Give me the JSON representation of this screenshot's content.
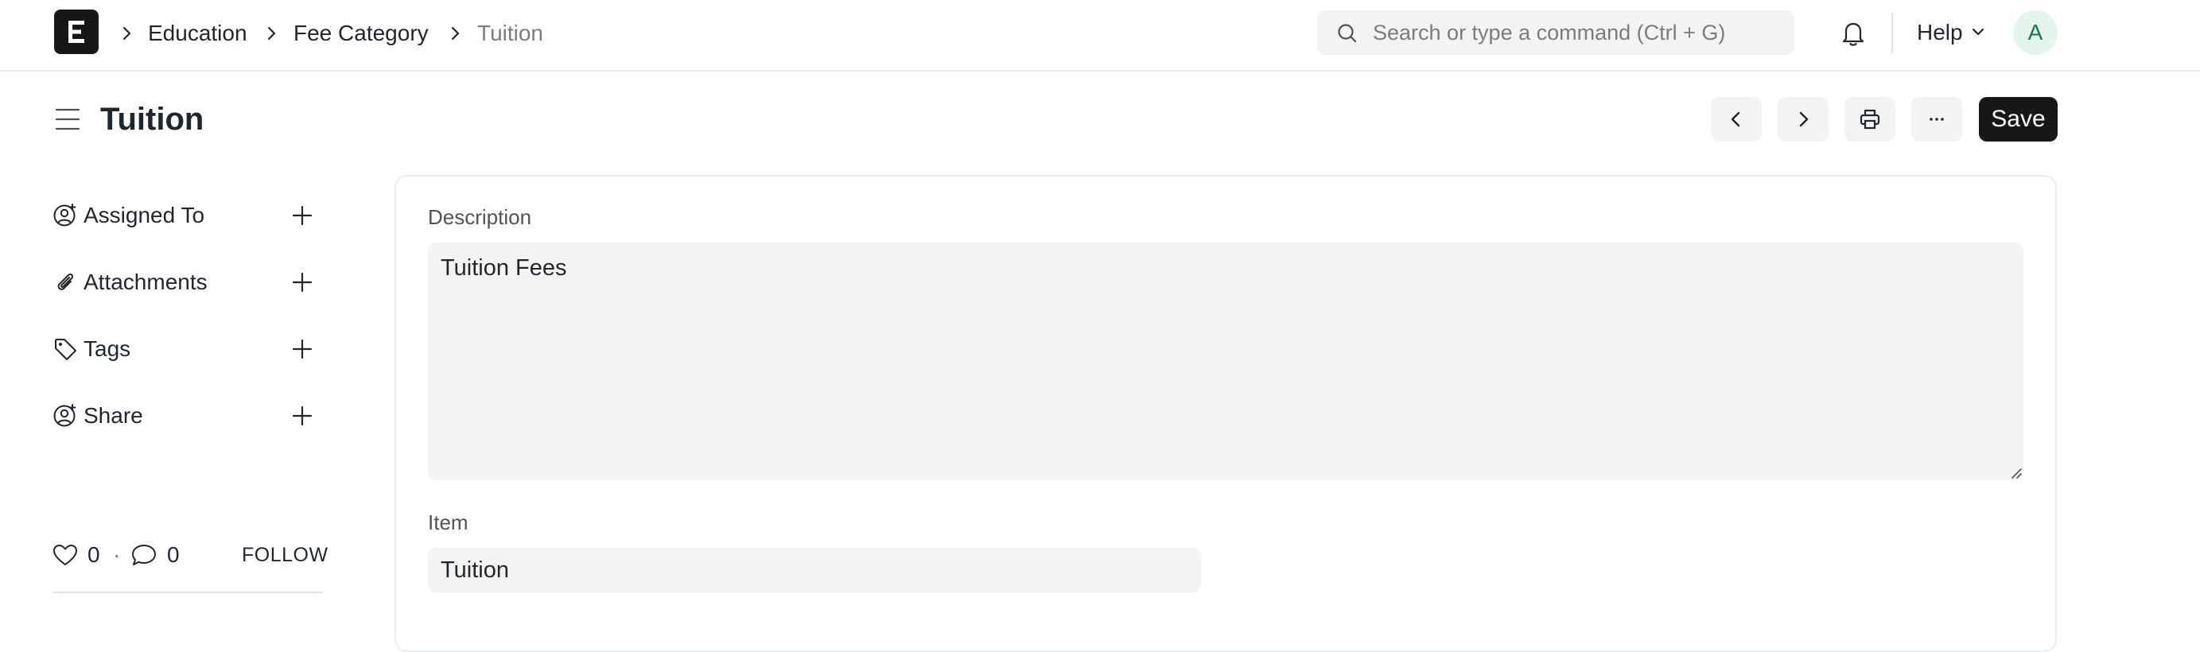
{
  "navbar": {
    "breadcrumbs": [
      {
        "label": "Education"
      },
      {
        "label": "Fee Category"
      },
      {
        "label": "Tuition"
      }
    ],
    "search": {
      "placeholder": "Search or type a command (Ctrl + G)"
    },
    "help_label": "Help",
    "avatar_initial": "A"
  },
  "page": {
    "title": "Tuition",
    "save_label": "Save",
    "more_label": "···"
  },
  "sidebar": {
    "items": [
      {
        "label": "Assigned To",
        "icon": "user-add-icon"
      },
      {
        "label": "Attachments",
        "icon": "paperclip-icon"
      },
      {
        "label": "Tags",
        "icon": "tag-icon"
      },
      {
        "label": "Share",
        "icon": "share-user-icon"
      }
    ],
    "likes": "0",
    "comments": "0",
    "separator": "·",
    "follow_label": "FOLLOW"
  },
  "form": {
    "description": {
      "label": "Description",
      "value": "Tuition Fees"
    },
    "item": {
      "label": "Item",
      "value": "Tuition"
    }
  },
  "colors": {
    "primary_button": "#171717",
    "input_bg": "#f3f3f3",
    "avatar_bg": "#e4f5e9",
    "avatar_text": "#16794c"
  }
}
